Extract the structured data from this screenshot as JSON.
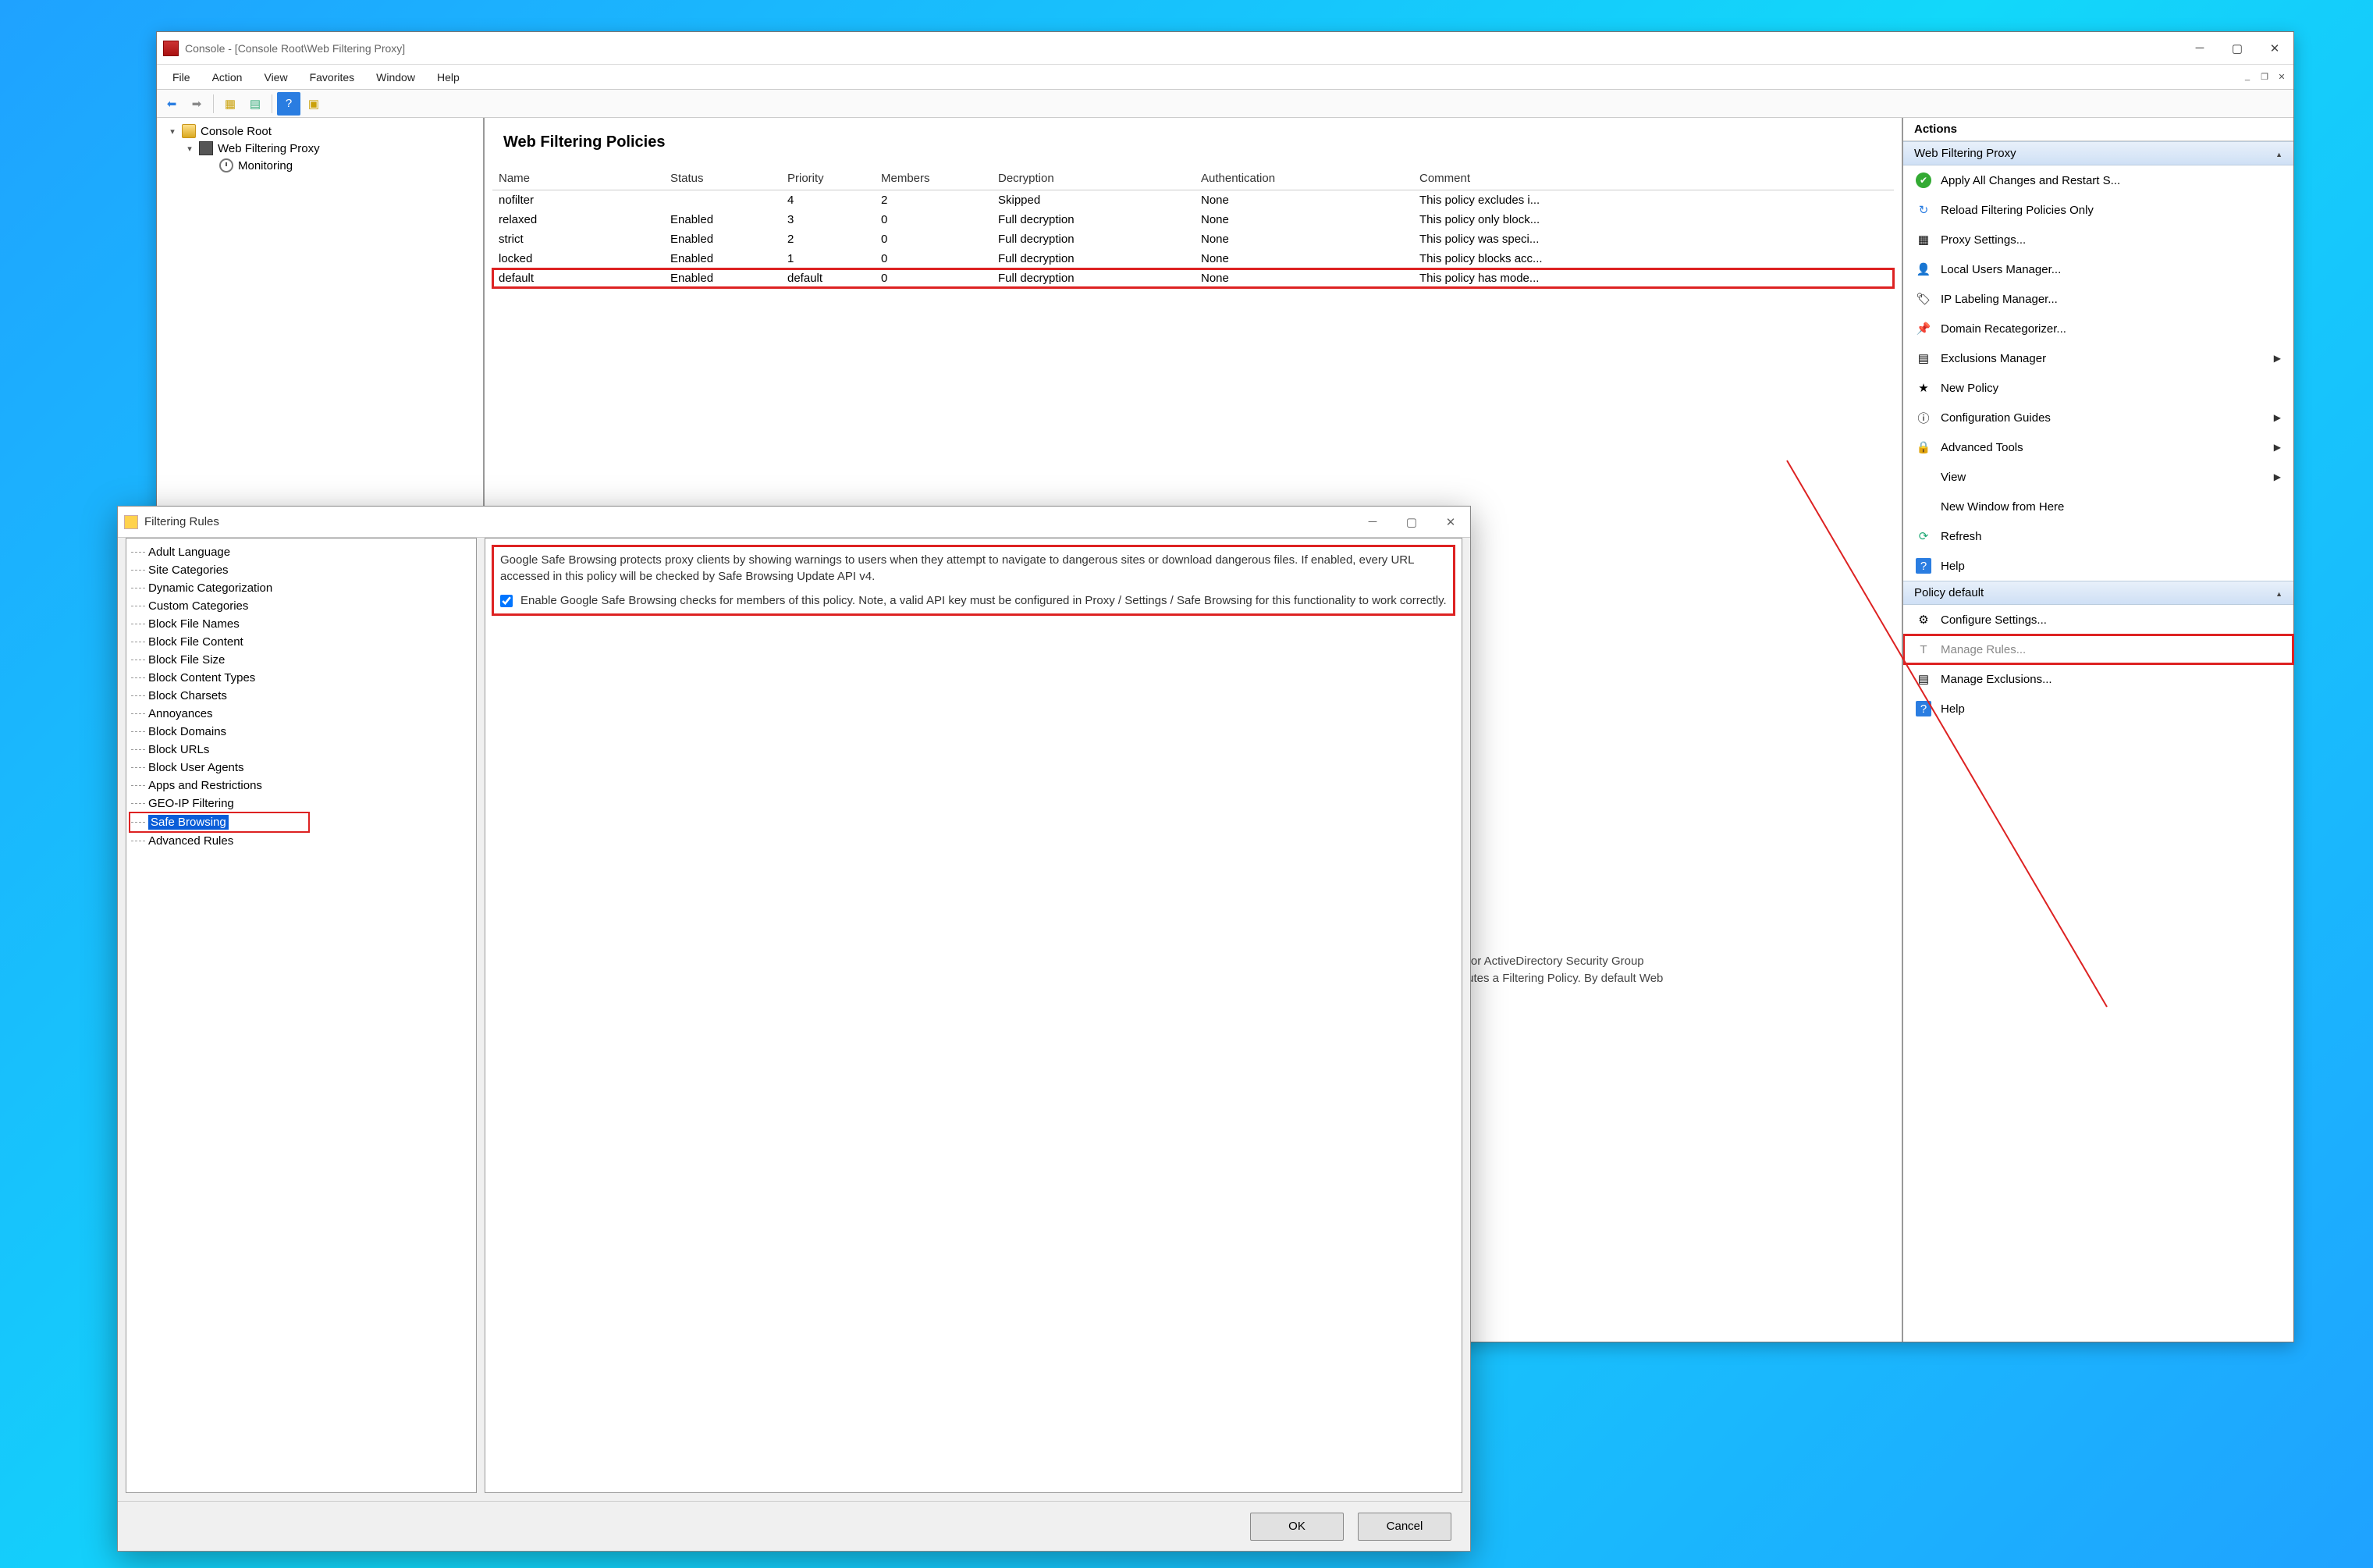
{
  "mainWindow": {
    "title": "Console - [Console Root\\Web Filtering Proxy]",
    "menus": [
      "File",
      "Action",
      "View",
      "Favorites",
      "Window",
      "Help"
    ]
  },
  "tree": {
    "root": "Console Root",
    "proxy": "Web Filtering Proxy",
    "monitoring": "Monitoring"
  },
  "center": {
    "heading": "Web Filtering Policies",
    "columns": [
      "Name",
      "Status",
      "Priority",
      "Members",
      "Decryption",
      "Authentication",
      "Comment"
    ],
    "rows": [
      {
        "name": "nofilter",
        "status": "",
        "priority": "4",
        "members": "2",
        "decryption": "Skipped",
        "auth": "None",
        "comment": "This policy excludes i..."
      },
      {
        "name": "relaxed",
        "status": "Enabled",
        "priority": "3",
        "members": "0",
        "decryption": "Full decryption",
        "auth": "None",
        "comment": "This policy only block..."
      },
      {
        "name": "strict",
        "status": "Enabled",
        "priority": "2",
        "members": "0",
        "decryption": "Full decryption",
        "auth": "None",
        "comment": "This policy was speci..."
      },
      {
        "name": "locked",
        "status": "Enabled",
        "priority": "1",
        "members": "0",
        "decryption": "Full decryption",
        "auth": "None",
        "comment": "This policy blocks acc..."
      },
      {
        "name": "default",
        "status": "Enabled",
        "priority": "default",
        "members": "0",
        "decryption": "Full decryption",
        "auth": "None",
        "comment": "This policy has mode..."
      }
    ],
    "bg_line1": "AP or ActiveDirectory Security Group",
    "bg_line2": "stitutes a Filtering Policy. By default Web"
  },
  "actions": {
    "header": "Actions",
    "section1": "Web Filtering Proxy",
    "section1_items": [
      {
        "icon": "check",
        "label": "Apply All Changes and Restart S..."
      },
      {
        "icon": "reload",
        "label": "Reload Filtering Policies Only"
      },
      {
        "icon": "grid",
        "label": "Proxy Settings..."
      },
      {
        "icon": "user",
        "label": "Local Users Manager..."
      },
      {
        "icon": "tag",
        "label": "IP Labeling Manager..."
      },
      {
        "icon": "pin",
        "label": "Domain Recategorizer..."
      },
      {
        "icon": "list",
        "label": "Exclusions Manager",
        "arrow": true
      },
      {
        "icon": "star",
        "label": "New Policy"
      },
      {
        "icon": "info",
        "label": "Configuration Guides",
        "arrow": true
      },
      {
        "icon": "lock",
        "label": "Advanced Tools",
        "arrow": true
      },
      {
        "icon": "",
        "label": "View",
        "arrow": true
      },
      {
        "icon": "",
        "label": "New Window from Here"
      },
      {
        "icon": "refresh",
        "label": "Refresh"
      },
      {
        "icon": "help",
        "label": "Help"
      }
    ],
    "section2": "Policy default",
    "section2_items": [
      {
        "icon": "gear",
        "label": "Configure Settings..."
      },
      {
        "icon": "T",
        "label": "Manage Rules...",
        "hot": true
      },
      {
        "icon": "list",
        "label": "Manage Exclusions..."
      },
      {
        "icon": "help",
        "label": "Help"
      }
    ]
  },
  "dialog": {
    "title": "Filtering Rules",
    "categories": [
      "Adult Language",
      "Site Categories",
      "Dynamic Categorization",
      "Custom Categories",
      "Block File Names",
      "Block File Content",
      "Block File Size",
      "Block Content Types",
      "Block Charsets",
      "Annoyances",
      "Block Domains",
      "Block URLs",
      "Block User Agents",
      "Apps and Restrictions",
      "GEO-IP Filtering",
      "Safe Browsing",
      "Advanced Rules"
    ],
    "selectedIndex": 15,
    "description": "Google Safe Browsing protects proxy clients by showing warnings to users when they attempt to navigate to dangerous sites or download dangerous files. If enabled, every URL accessed in this policy will be checked by Safe Browsing Update API v4.",
    "checkboxLabel": "Enable Google Safe Browsing checks for members of this policy. Note, a valid API key must be configured in Proxy / Settings / Safe Browsing for this functionality to work correctly.",
    "checkboxChecked": true,
    "ok": "OK",
    "cancel": "Cancel"
  }
}
